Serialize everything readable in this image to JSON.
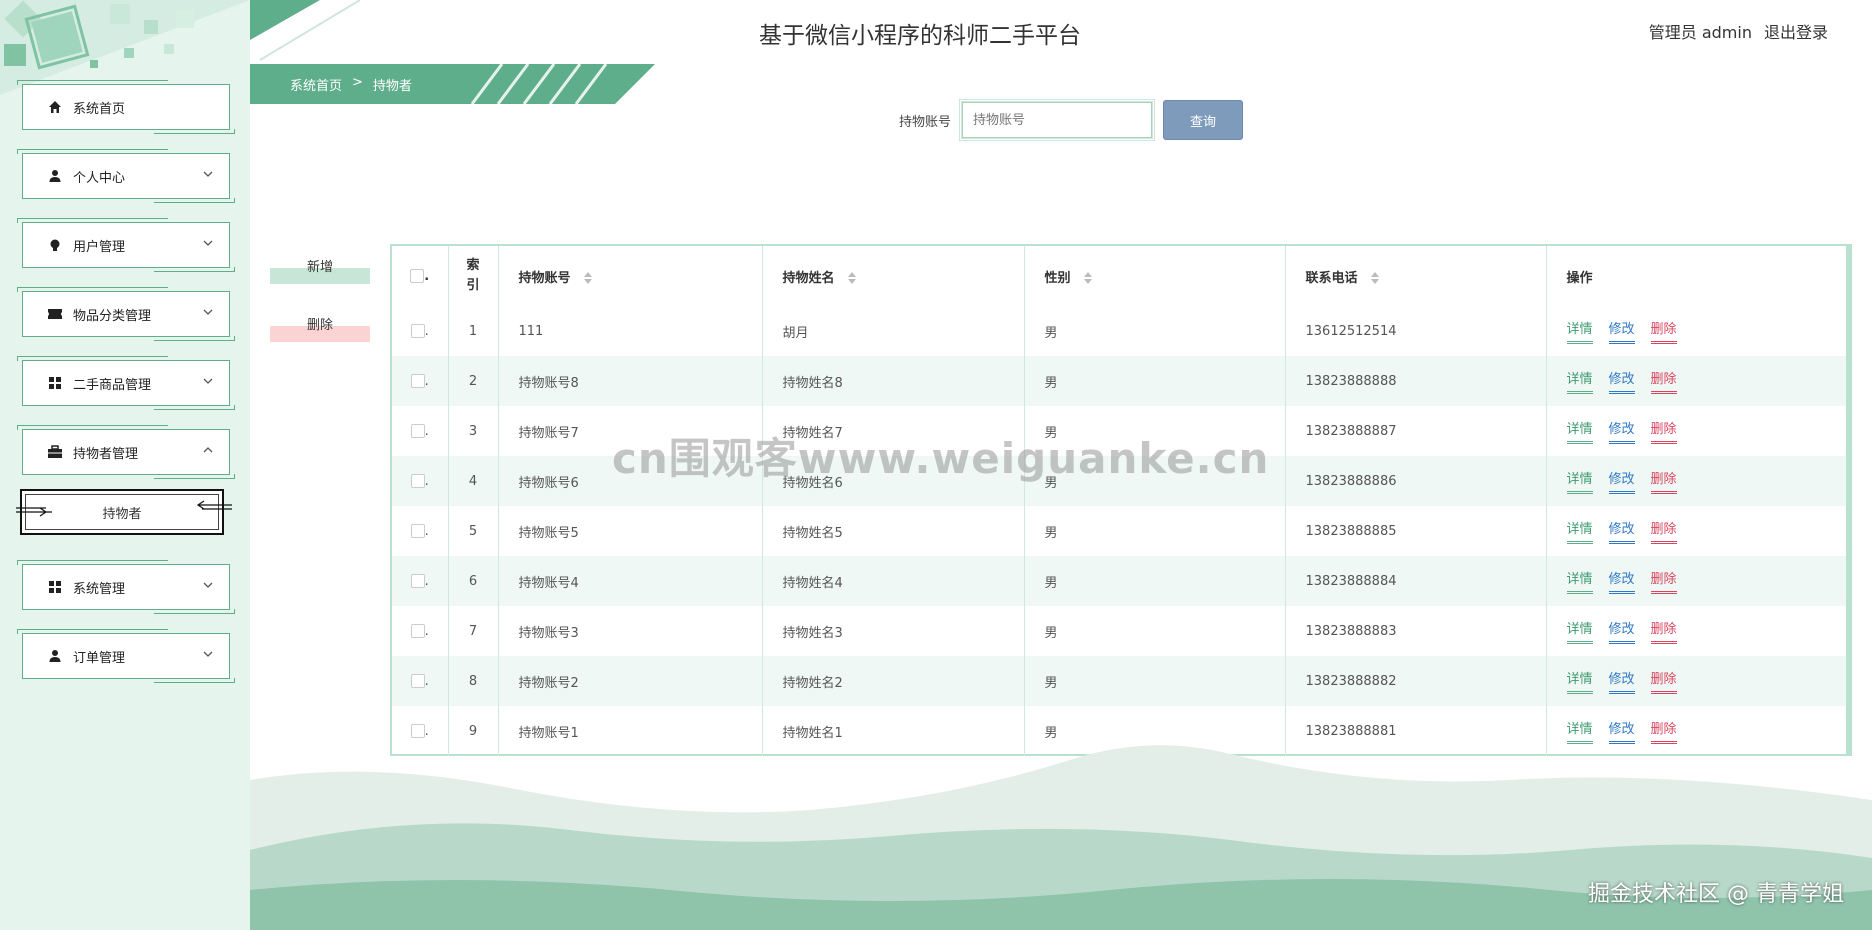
{
  "app": {
    "title": "基于微信小程序的科师二手平台",
    "user_label": "管理员 admin",
    "logout_label": "退出登录"
  },
  "breadcrumb": {
    "home": "系统首页",
    "separator": ">",
    "current": "持物者"
  },
  "sidebar": {
    "items": [
      {
        "label": "系统首页",
        "icon": "home-icon"
      },
      {
        "label": "个人中心",
        "icon": "user-icon"
      },
      {
        "label": "用户管理",
        "icon": "bulb-icon"
      },
      {
        "label": "物品分类管理",
        "icon": "ticket-icon"
      },
      {
        "label": "二手商品管理",
        "icon": "grid-icon"
      },
      {
        "label": "持物者管理",
        "icon": "briefcase-icon"
      },
      {
        "label": "系统管理",
        "icon": "grid-icon"
      },
      {
        "label": "订单管理",
        "icon": "user-icon"
      }
    ],
    "sub_item": "持物者"
  },
  "search": {
    "label": "持物账号",
    "placeholder": "持物账号",
    "button": "查询"
  },
  "actions": {
    "add": "新增",
    "delete": "删除"
  },
  "table": {
    "headers": {
      "index": "索引",
      "account": "持物账号",
      "name": "持物姓名",
      "gender": "性别",
      "phone": "联系电话",
      "ops": "操作"
    },
    "op_labels": {
      "detail": "详情",
      "edit": "修改",
      "delete": "删除"
    },
    "rows": [
      {
        "index": "1",
        "account": "111",
        "name": "胡月",
        "gender": "男",
        "phone": "13612512514"
      },
      {
        "index": "2",
        "account": "持物账号8",
        "name": "持物姓名8",
        "gender": "男",
        "phone": "13823888888"
      },
      {
        "index": "3",
        "account": "持物账号7",
        "name": "持物姓名7",
        "gender": "男",
        "phone": "13823888887"
      },
      {
        "index": "4",
        "account": "持物账号6",
        "name": "持物姓名6",
        "gender": "男",
        "phone": "13823888886"
      },
      {
        "index": "5",
        "account": "持物账号5",
        "name": "持物姓名5",
        "gender": "男",
        "phone": "13823888885"
      },
      {
        "index": "6",
        "account": "持物账号4",
        "name": "持物姓名4",
        "gender": "男",
        "phone": "13823888884"
      },
      {
        "index": "7",
        "account": "持物账号3",
        "name": "持物姓名3",
        "gender": "男",
        "phone": "13823888883"
      },
      {
        "index": "8",
        "account": "持物账号2",
        "name": "持物姓名2",
        "gender": "男",
        "phone": "13823888882"
      },
      {
        "index": "9",
        "account": "持物账号1",
        "name": "持物姓名1",
        "gender": "男",
        "phone": "13823888881"
      }
    ]
  },
  "watermarks": {
    "center": "cn围观客www.weiguanke.cn",
    "corner": "掘金技术社区 @ 青青学姐"
  },
  "colors": {
    "accent": "#5fae8b",
    "sidebar_bg": "#e6f4ee",
    "search_btn": "#7f9bbb",
    "edit": "#3178c6",
    "delete": "#d9455f"
  }
}
